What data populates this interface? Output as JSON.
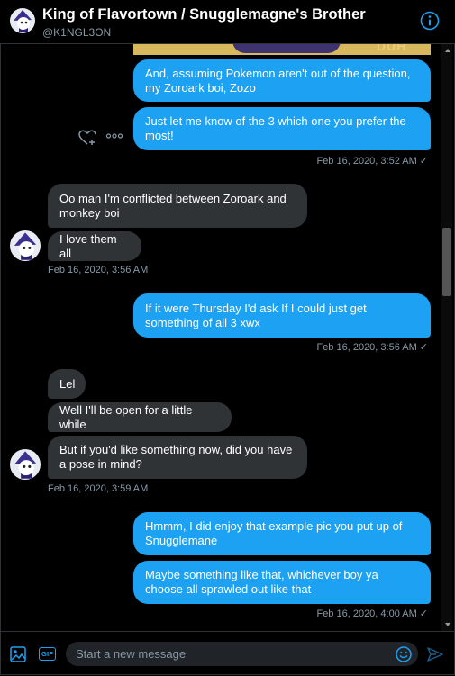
{
  "header": {
    "title": "King of Flavortown / Snugglemagne's Brother",
    "handle": "@K1NGL3ON",
    "accent": "#1da1f2"
  },
  "image_overlay_text": "DUH",
  "messages": [
    {
      "side": "out",
      "text": "And, assuming Pokemon aren't out of the question, my Zoroark boi, Zozo"
    },
    {
      "side": "out",
      "text": "Just let me know of the 3 which one you prefer the most!"
    },
    {
      "side": "out-ts",
      "text": "Feb 16, 2020, 3:52 AM"
    },
    {
      "side": "in",
      "text": "Oo man I'm conflicted between Zoroark and monkey boi"
    },
    {
      "side": "in",
      "text": "I love them all"
    },
    {
      "side": "in-ts",
      "text": "Feb 16, 2020, 3:56 AM"
    },
    {
      "side": "out",
      "text": "If it were Thursday I'd ask If I could just get something of all 3 xwx"
    },
    {
      "side": "out-ts",
      "text": "Feb 16, 2020, 3:56 AM"
    },
    {
      "side": "in",
      "text": "Lel"
    },
    {
      "side": "in",
      "text": "Well I'll be open for a little while"
    },
    {
      "side": "in",
      "text": "But if you'd like something now, did you have a pose in mind?"
    },
    {
      "side": "in-ts",
      "text": "Feb 16, 2020, 3:59 AM"
    },
    {
      "side": "out",
      "text": "Hmmm, I did enjoy that example pic you put up of Snugglemane"
    },
    {
      "side": "out",
      "text": "Maybe something like that, whichever boy ya choose all sprawled out like that"
    },
    {
      "side": "out-ts",
      "text": "Feb 16, 2020, 4:00 AM"
    }
  ],
  "composer": {
    "placeholder": "Start a new message",
    "gif_label": "GIF"
  },
  "icons": {
    "read_receipt": "✓",
    "more": "more-icon",
    "react": "heart-plus-icon",
    "info": "info-icon",
    "image": "image-icon",
    "gif": "gif-icon",
    "emoji": "emoji-icon",
    "send": "send-icon"
  },
  "colors": {
    "outgoing_bubble": "#1da1f2",
    "incoming_bubble": "#2f3336",
    "background": "#000000",
    "muted_text": "#8899a6"
  }
}
